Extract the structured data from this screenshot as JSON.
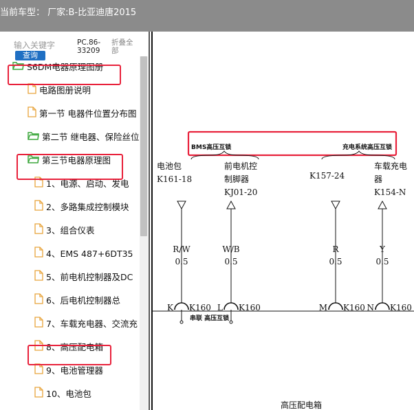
{
  "header": {
    "title": "当前车型： 厂家:B-比亚迪唐2015"
  },
  "search": {
    "placeholder": "输入关键字",
    "button_label": "查询",
    "code": "PC.86-33209",
    "collapse_label": "折叠全部"
  },
  "tree": {
    "items": [
      {
        "label": "S6DM电器原理图册"
      },
      {
        "label": "电路图册说明"
      },
      {
        "label": "第一节 电器件位置分布图"
      },
      {
        "label": "第二节 继电器、保险丝位"
      },
      {
        "label": "第三节电器原理图"
      },
      {
        "label": "1、电源、启动、发电"
      },
      {
        "label": "2、多路集成控制模块"
      },
      {
        "label": "3、组合仪表"
      },
      {
        "label": "4、EMS 487+6DT35"
      },
      {
        "label": "5、前电机控制器及DC"
      },
      {
        "label": "6、后电机控制器总"
      },
      {
        "label": "7、车载充电器、交流充"
      },
      {
        "label": "8、高压配电箱"
      },
      {
        "label": "9、电池管理器"
      },
      {
        "label": "10、电池包"
      }
    ]
  },
  "diagram": {
    "bms_label": "BMS高压互锁",
    "charge_label": "充电系统高压互锁",
    "columns": [
      {
        "name_line1": "电池包",
        "name_line2": "",
        "code": "K161-18",
        "wire": "R/W",
        "gauge": "0.5",
        "pin": "K",
        "connector": "K160",
        "arrow": "down"
      },
      {
        "name_line1": "前电机控",
        "name_line2": "制脚器",
        "code": "KJ01-20",
        "wire": "W/B",
        "gauge": "0.5",
        "pin": "L",
        "connector": "K160",
        "arrow": "up"
      },
      {
        "name_line1": "",
        "name_line2": "",
        "code": "K157-24",
        "wire": "R",
        "gauge": "0.5",
        "pin": "M",
        "connector": "K160",
        "arrow": "down"
      },
      {
        "name_line1": "车载充电",
        "name_line2": "器",
        "code": "K154-N",
        "wire": "Y",
        "gauge": "0.5",
        "pin": "N",
        "connector": "K160",
        "arrow": "up"
      }
    ],
    "series_label": "串联 高压互锁",
    "footer_title": "高压配电箱"
  },
  "colors": {
    "title_bar": "#8b8b8b",
    "highlight": "#e8203a",
    "button": "#1f6fc3",
    "folder_icon": "#3aa63a",
    "file_icon": "#e8a33a"
  }
}
